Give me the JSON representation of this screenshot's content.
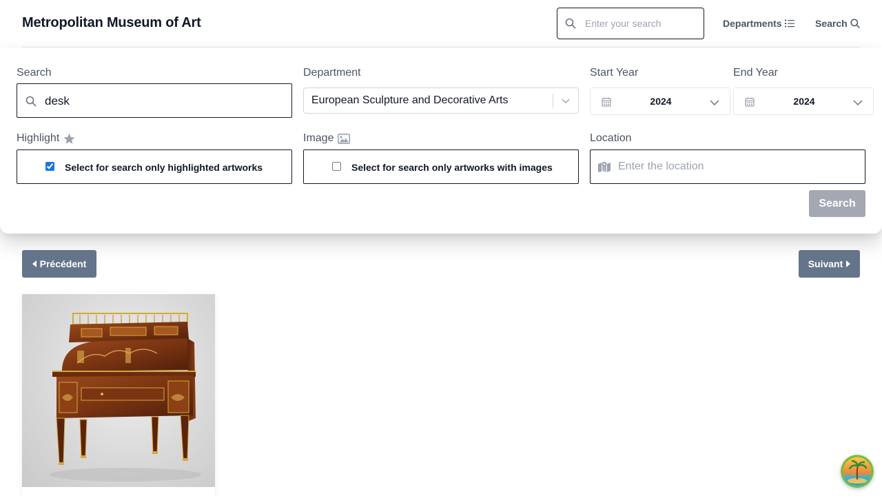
{
  "header": {
    "brand": "Metropolitan Museum of Art",
    "search_placeholder": "Enter your search",
    "nav": [
      {
        "label": "Departments",
        "icon": "list-icon"
      },
      {
        "label": "Search",
        "icon": "search-icon"
      }
    ]
  },
  "filters": {
    "search": {
      "label": "Search",
      "value": "desk"
    },
    "department": {
      "label": "Department",
      "value": "European Sculpture and Decorative Arts"
    },
    "start_year": {
      "label": "Start Year",
      "value": "2024"
    },
    "end_year": {
      "label": "End Year",
      "value": "2024"
    },
    "highlight": {
      "label": "Highlight",
      "checkbox_text": "Select for search only highlighted artworks",
      "checked": true
    },
    "image": {
      "label": "Image",
      "checkbox_text": "Select for search only artworks with images",
      "checked": false
    },
    "location": {
      "label": "Location",
      "placeholder": "Enter the location"
    },
    "search_button": "Search"
  },
  "pagination": {
    "prev_label": "Précédent",
    "next_label": "Suivant"
  },
  "colors": {
    "pagination_button": "#64748b",
    "disabled_search_button": "#a3a8b3",
    "checkbox_accent": "#1a73e8"
  }
}
